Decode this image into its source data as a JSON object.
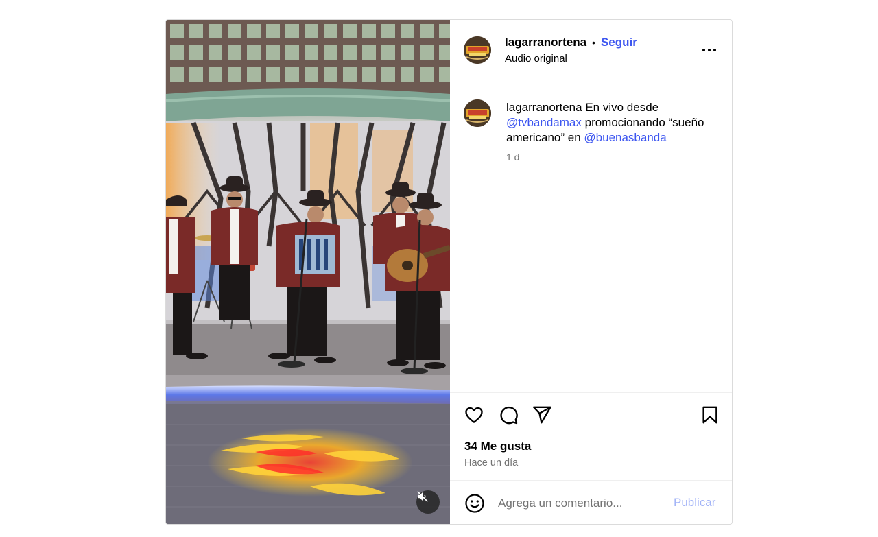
{
  "post": {
    "username": "lagarranortena",
    "separator": "•",
    "follow_label": "Seguir",
    "audio_label": "Audio original",
    "more_icon": "more-horizontal-icon",
    "caption": {
      "username": "lagarranortena",
      "text_1": "En vivo desde",
      "mention_1": "@tvbandamax",
      "text_2": "promocionando “sueño americano” en",
      "mention_2": "@buenasbanda",
      "age": "1 d"
    },
    "actions": {
      "like_icon": "heart-icon",
      "comment_icon": "comment-icon",
      "share_icon": "send-icon",
      "save_icon": "bookmark-icon"
    },
    "likes_label": "34 Me gusta",
    "posted_label": "Hace un día",
    "comment": {
      "emoji_icon": "emoji-icon",
      "placeholder": "Agrega un comentario...",
      "publish_label": "Publicar"
    },
    "media": {
      "mute_icon": "speaker-muted-icon"
    }
  },
  "colors": {
    "link": "#3d56f0",
    "publish_disabled": "#a3b4f7",
    "secondary_text": "#737373",
    "border": "#dbdbdb"
  }
}
